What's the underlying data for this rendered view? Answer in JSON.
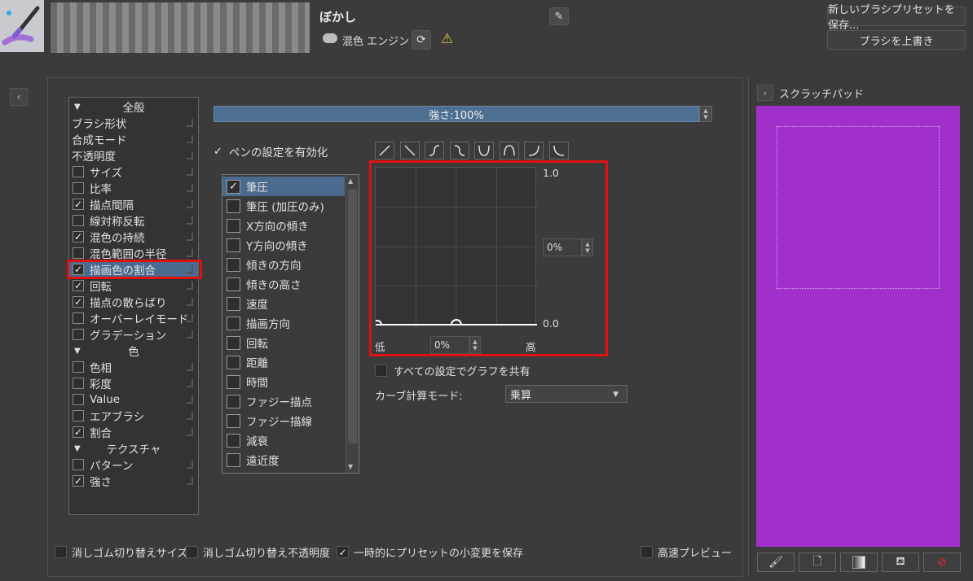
{
  "header": {
    "preset_name": "ぼかし",
    "engine_label": "混色 エンジン",
    "new_preset_button": "新しいブラシプリセットを保存...",
    "overwrite_button": "ブラシを上書き",
    "edit_icon": "pencil-icon",
    "sync_icon": "reload-icon",
    "warning_icon": "warning-icon"
  },
  "categories": {
    "groups": [
      {
        "label": "全般"
      },
      {
        "label": "色"
      },
      {
        "label": "テクスチャ"
      }
    ],
    "items": [
      {
        "label": "ブラシ形状",
        "checkbox": false
      },
      {
        "label": "合成モード",
        "checkbox": false
      },
      {
        "label": "不透明度",
        "checkbox": false
      },
      {
        "label": "サイズ",
        "checkbox": true,
        "checked": false
      },
      {
        "label": "比率",
        "checkbox": true,
        "checked": false
      },
      {
        "label": "描点間隔",
        "checkbox": true,
        "checked": true
      },
      {
        "label": "線対称反転",
        "checkbox": true,
        "checked": false
      },
      {
        "label": "混色の持続",
        "checkbox": true,
        "checked": true
      },
      {
        "label": "混色範囲の半径",
        "checkbox": true,
        "checked": false
      },
      {
        "label": "描画色の割合",
        "checkbox": true,
        "checked": true,
        "selected": true
      },
      {
        "label": "回転",
        "checkbox": true,
        "checked": true
      },
      {
        "label": "描点の散らばり",
        "checkbox": true,
        "checked": true
      },
      {
        "label": "オーバーレイモード",
        "checkbox": true,
        "checked": false
      },
      {
        "label": "グラデーション",
        "checkbox": true,
        "checked": false
      },
      {
        "label": "色相",
        "checkbox": true,
        "checked": false
      },
      {
        "label": "彩度",
        "checkbox": true,
        "checked": false
      },
      {
        "label": "Value",
        "checkbox": true,
        "checked": false
      },
      {
        "label": "エアブラシ",
        "checkbox": true,
        "checked": false
      },
      {
        "label": "割合",
        "checkbox": true,
        "checked": true
      },
      {
        "label": "パターン",
        "checkbox": true,
        "checked": false
      },
      {
        "label": "強さ",
        "checkbox": true,
        "checked": true
      }
    ]
  },
  "strength": {
    "label": "強さ:100%",
    "value": 1.0
  },
  "pen_settings": {
    "label": "ペンの設定を有効化",
    "checked": true
  },
  "sensors": [
    {
      "label": "筆圧",
      "checked": true,
      "selected": true
    },
    {
      "label": "筆圧 (加圧のみ)",
      "checked": false
    },
    {
      "label": "X方向の傾き",
      "checked": false
    },
    {
      "label": "Y方向の傾き",
      "checked": false
    },
    {
      "label": "傾きの方向",
      "checked": false
    },
    {
      "label": "傾きの高さ",
      "checked": false
    },
    {
      "label": "速度",
      "checked": false
    },
    {
      "label": "描画方向",
      "checked": false
    },
    {
      "label": "回転",
      "checked": false
    },
    {
      "label": "距離",
      "checked": false
    },
    {
      "label": "時間",
      "checked": false
    },
    {
      "label": "ファジー描点",
      "checked": false
    },
    {
      "label": "ファジー描線",
      "checked": false
    },
    {
      "label": "減衰",
      "checked": false
    },
    {
      "label": "遠近度",
      "checked": false
    }
  ],
  "curve": {
    "y_max_label": "1.0",
    "y_min_label": "0.0",
    "y_value": "0%",
    "x_low_label": "低",
    "x_high_label": "高",
    "x_value": "0%",
    "preset_icons": [
      "linear-up-icon",
      "linear-down-icon",
      "s-curve-up-icon",
      "s-curve-down-icon",
      "u-curve-icon",
      "arch-curve-icon",
      "j-curve-icon",
      "l-curve-icon"
    ]
  },
  "share_graph": {
    "label": "すべての設定でグラフを共有",
    "checked": false
  },
  "calc_mode": {
    "label": "カーブ計算モード:",
    "value": "乗算"
  },
  "bottom_options": {
    "eraser_size": "消しゴム切り替えサイズ",
    "eraser_opacity": "消しゴム切り替え不透明度",
    "temp_save": "一時的にプリセットの小変更を保存",
    "fast_preview": "高速プレビュー"
  },
  "scratchpad": {
    "title": "スクラッチパッド",
    "canvas_color": "#a02fcb",
    "tools": [
      "brush-icon",
      "page-icon",
      "gradient-icon",
      "fill-icon",
      "clear-icon"
    ]
  }
}
